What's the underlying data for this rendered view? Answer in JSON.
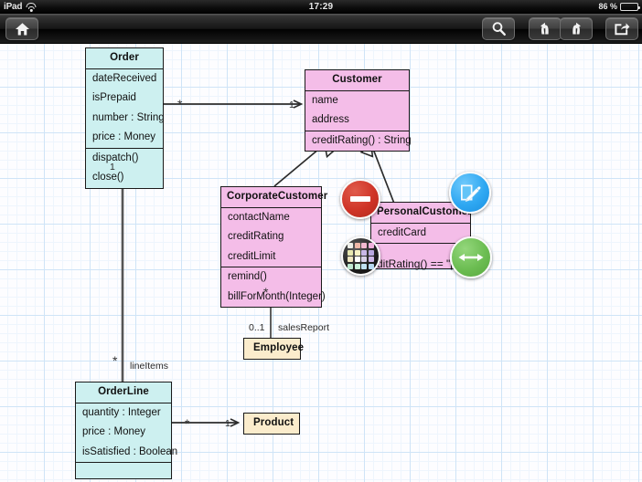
{
  "statusbar": {
    "carrier": "iPad",
    "wifi_icon": "wifi-icon",
    "time": "17:29",
    "battery_percent": "86 %",
    "battery_icon": "battery-icon"
  },
  "toolbar": {
    "buttons": [
      {
        "name": "home-button",
        "icon": "home-icon"
      },
      {
        "name": "search-button",
        "icon": "search-icon"
      },
      {
        "name": "undo-button",
        "icon": "undo-arrow-icon"
      },
      {
        "name": "redo-button",
        "icon": "redo-arrow-icon"
      },
      {
        "name": "share-button",
        "icon": "share-export-icon"
      }
    ]
  },
  "diagram": {
    "classes": [
      {
        "id": "order",
        "name": "Order",
        "attributes": [
          "dateReceived",
          "isPrepaid",
          "number : String",
          "price : Money"
        ],
        "operations": [
          "dispatch()",
          "close()"
        ],
        "color": "#cdf0f0"
      },
      {
        "id": "customer",
        "name": "Customer",
        "attributes": [
          "name",
          "address"
        ],
        "operations": [
          "creditRating() : String"
        ],
        "color": "#f4bde8"
      },
      {
        "id": "corporatecustomer",
        "name": "CorporateCustomer",
        "attributes": [
          "contactName",
          "creditRating",
          "creditLimit"
        ],
        "operations": [
          "remind()",
          "billForMonth(Integer)"
        ],
        "color": "#f4bde8"
      },
      {
        "id": "personalcustomer",
        "name": "PersonalCustomer",
        "attributes": [
          "creditCard"
        ],
        "operations": [],
        "color": "#f4bde8"
      },
      {
        "id": "employee",
        "name": "Employee",
        "attributes": [],
        "operations": [],
        "color": "#fbeccc"
      },
      {
        "id": "orderline",
        "name": "OrderLine",
        "attributes": [
          "quantity : Integer",
          "price : Money",
          "isSatisfied : Boolean"
        ],
        "operations": [],
        "color": "#cdf0f0"
      },
      {
        "id": "product",
        "name": "Product",
        "attributes": [],
        "operations": [],
        "color": "#fbeccc"
      }
    ],
    "labels": {
      "order_customer_source": "*",
      "order_customer_target": "1",
      "order_lineitems_one": "1",
      "order_lineitems_star": "*",
      "lineitems_role": "lineItems",
      "corporate_employee_mult": "0..1",
      "sales_report_role": "salesReport",
      "corporate_employee_star": "*",
      "orderline_product_star": "*",
      "orderline_product_one": "1",
      "constraint_note": "ditRating() == \"po"
    }
  },
  "fabs": [
    {
      "name": "delete-fab",
      "icon": "minus-circle-icon",
      "color": "#cf3427"
    },
    {
      "name": "edit-fab",
      "icon": "pencil-edit-icon",
      "color": "#2fa8f2"
    },
    {
      "name": "palette-fab",
      "icon": "color-palette-icon",
      "color": "#1e1e1e"
    },
    {
      "name": "resize-fab",
      "icon": "double-arrow-icon",
      "color": "#6cbd52"
    }
  ],
  "palette_colors": [
    "#f0f0ea",
    "#f0b8a8",
    "#f2b8cf",
    "#f0b0dc",
    "#e8e8b0",
    "#f7f2c4",
    "#c9b8e8",
    "#b8a8e0",
    "#f0e8c0",
    "#ffffff",
    "#d8d0e8",
    "#cdb8e8",
    "#bfe8d0",
    "#c8f0d8",
    "#bfe0f0",
    "#b8d8f0"
  ]
}
